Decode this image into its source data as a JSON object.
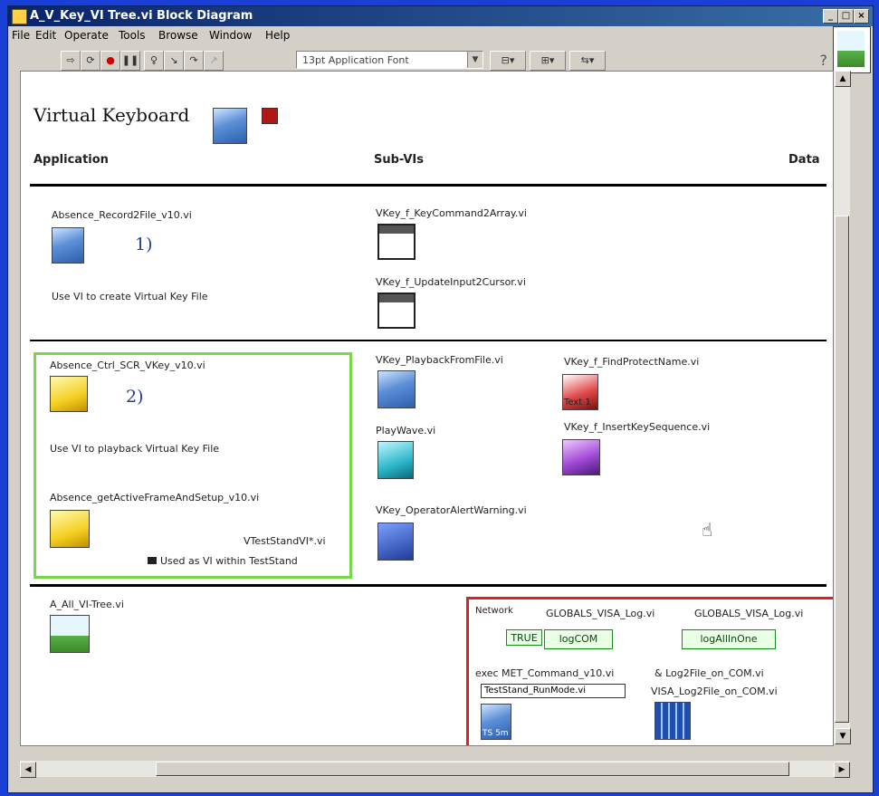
{
  "window": {
    "title": "A_V_Key_VI Tree.vi Block Diagram",
    "controls": {
      "minimize": "_",
      "maximize": "□",
      "close": "×"
    }
  },
  "menu": [
    "File",
    "Edit",
    "Operate",
    "Tools",
    "Browse",
    "Window",
    "Help"
  ],
  "toolbar": {
    "font_select": "13pt Application Font",
    "icons": [
      "run-arrow-icon",
      "run-continuous-icon",
      "abort-icon",
      "pause-icon",
      "highlight-execution-icon",
      "step-into-icon",
      "step-over-icon",
      "step-out-icon",
      "align-icon",
      "distribute-icon",
      "reorder-icon"
    ],
    "help": "?"
  },
  "diagram": {
    "title": "Virtual Keyboard",
    "headers": {
      "application": "Application",
      "sub_vis": "Sub-VIs",
      "data": "Data"
    },
    "section1": {
      "label": "1)",
      "app_vi": "Absence_Record2File_v10.vi",
      "app_desc": "Use VI to create Virtual Key File",
      "sub1": "VKey_f_KeyCommand2Array.vi",
      "sub2": "VKey_f_UpdateInput2Cursor.vi"
    },
    "section2": {
      "label": "2)",
      "app_vi": "Absence_Ctrl_SCR_VKey_v10.vi",
      "app_desc": "Use VI to playback Virtual Key File",
      "app_vi2": "Absence_getActiveFrameAndSetup_v10.vi",
      "teststand_vi": "VTestStandVI*.vi",
      "teststand_note": "Used as VI within TestStand",
      "sub_playback": "VKey_PlaybackFromFile.vi",
      "sub_play_wave": "PlayWave.vi",
      "sub_operator": "VKey_OperatorAlertWarning.vi",
      "sub_find": "VKey_f_FindProtectName.vi",
      "sub_find_label": "Text 1",
      "sub_sequence": "VKey_f_InsertKeySequence.vi"
    },
    "section3": {
      "app_vi": "A_All_VI-Tree.vi",
      "network": "Network",
      "global1": "GLOBALS_VISA_Log.vi",
      "global2": "GLOBALS_VISA_Log.vi",
      "wire_true": "TRUE",
      "wire_logcom": "logCOM",
      "wire_logallinone": "logAllInOne",
      "exec": "exec MET_Command_v10.vi",
      "log2file": "& Log2File_on_COM.vi",
      "teststand_mode": "TestStand_RunMode.vi",
      "visa_log": "VISA_Log2File_on_COM.vi",
      "teststand_icon_label": "TS 5m"
    }
  }
}
